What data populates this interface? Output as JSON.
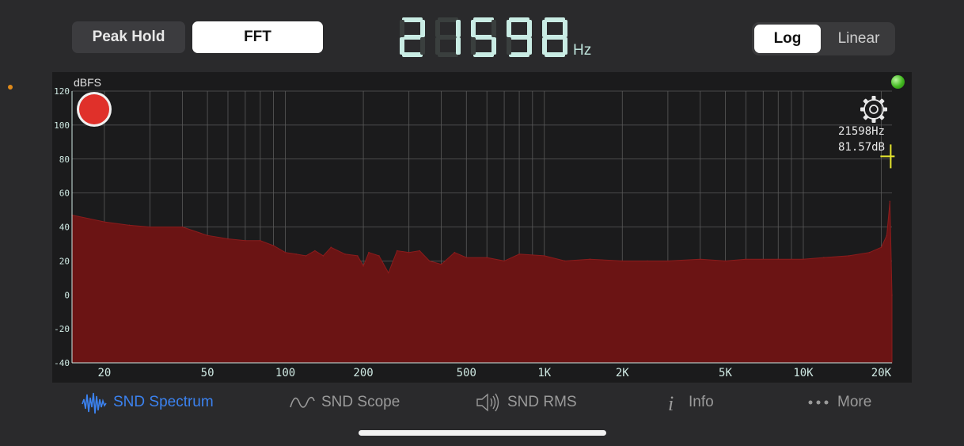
{
  "header": {
    "peak_hold_label": "Peak Hold",
    "fft_label": "FFT",
    "frequency_readout": "21598",
    "frequency_unit": "Hz",
    "scale_log_label": "Log",
    "scale_linear_label": "Linear",
    "selected_scale": "Log"
  },
  "plot": {
    "y_unit_label": "dBFS",
    "cursor_freq": "21598Hz",
    "cursor_level": "81.57dB",
    "status_led_color": "#41b81f",
    "record_button_color": "#e0302a",
    "fill_color": "#6b1414"
  },
  "chart_data": {
    "type": "area",
    "x_scale": "log",
    "xlim": [
      15,
      22000
    ],
    "ylim": [
      -40,
      120
    ],
    "y_ticks": [
      "120",
      "100",
      "80",
      "60",
      "40",
      "20",
      "0",
      "-20",
      "-40"
    ],
    "x_ticks": [
      "20",
      "50",
      "100",
      "200",
      "500",
      "1K",
      "2K",
      "5K",
      "10K",
      "20K"
    ],
    "grid": true,
    "x": [
      15,
      20,
      25,
      30,
      40,
      50,
      60,
      70,
      80,
      90,
      100,
      110,
      120,
      130,
      140,
      150,
      170,
      190,
      200,
      210,
      230,
      250,
      270,
      300,
      330,
      360,
      400,
      450,
      500,
      600,
      700,
      800,
      1000,
      1200,
      1500,
      2000,
      2500,
      3000,
      4000,
      5000,
      6000,
      8000,
      10000,
      12000,
      15000,
      18000,
      20000,
      21000,
      21598,
      22000
    ],
    "values": [
      47,
      43,
      41,
      40,
      40,
      35,
      33,
      32,
      32,
      29,
      25,
      24,
      23,
      26,
      23,
      28,
      24,
      23,
      17,
      25,
      23,
      13,
      26,
      25,
      26,
      20,
      18,
      25,
      22,
      22,
      20,
      24,
      23,
      20,
      21,
      20,
      20,
      20,
      21,
      20,
      21,
      21,
      21,
      22,
      23,
      25,
      28,
      35,
      55,
      0
    ],
    "cursor": {
      "x": 21598,
      "y": 81.57
    }
  },
  "tabs": [
    {
      "label": "SND Spectrum",
      "icon": "waveform-icon",
      "active": true
    },
    {
      "label": "SND Scope",
      "icon": "sine-wave-icon",
      "active": false
    },
    {
      "label": "SND RMS",
      "icon": "speaker-icon",
      "active": false
    },
    {
      "label": "Info",
      "icon": "info-icon",
      "active": false
    },
    {
      "label": "More",
      "icon": "ellipsis-icon",
      "active": false
    }
  ],
  "colors": {
    "accent": "#3b82f0",
    "lcd_digit": "#c9ece4",
    "axis_text": "#cfe9e3",
    "cursor": "#e6e62e"
  }
}
